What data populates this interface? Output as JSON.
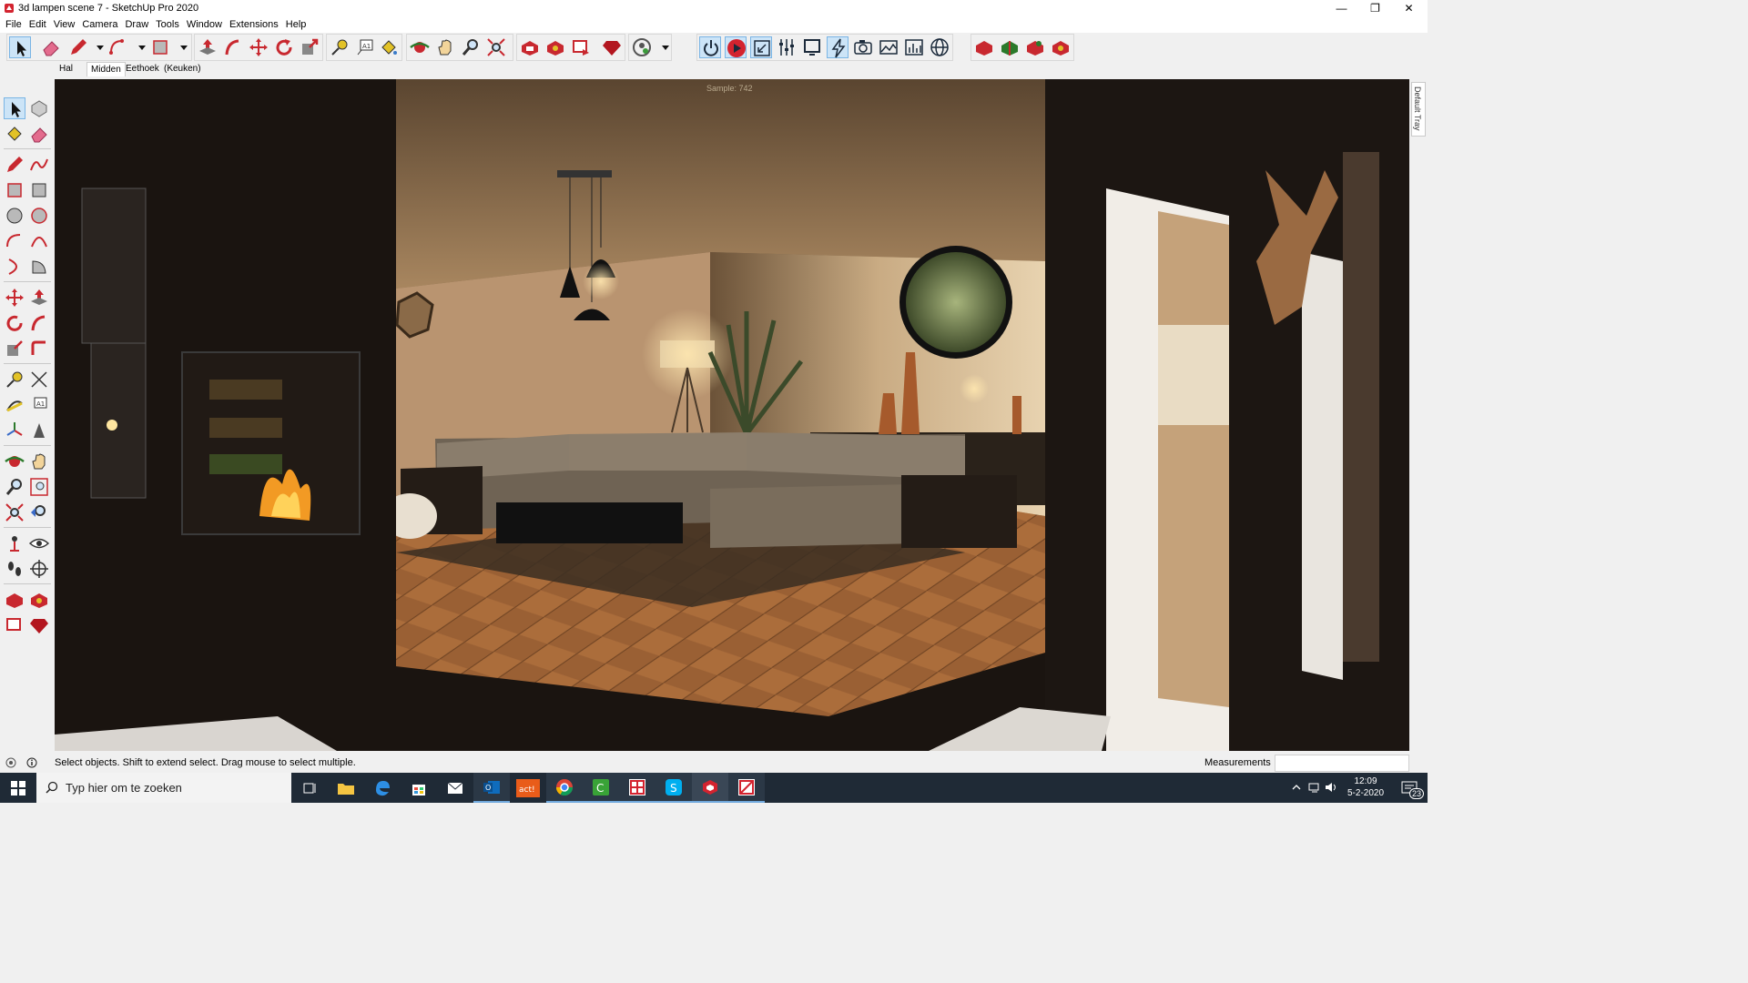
{
  "window": {
    "title": "3d lampen scene 7 - SketchUp Pro 2020",
    "minimize": "—",
    "maximize": "❐",
    "close": "✕"
  },
  "menu": [
    "File",
    "Edit",
    "View",
    "Camera",
    "Draw",
    "Tools",
    "Window",
    "Extensions",
    "Help"
  ],
  "scene_tabs": [
    {
      "label": "Hal",
      "active": false
    },
    {
      "label": "Midden",
      "active": true
    },
    {
      "label": "Eethoek",
      "active": false
    },
    {
      "label": "(Keuken)",
      "active": false
    }
  ],
  "toolbar_icons": [
    "select-icon",
    "eraser-icon",
    "pencil-icon",
    "dropdown-arrow",
    "arc-icon",
    "dropdown-arrow",
    "rectangle-icon",
    "dropdown-arrow",
    "push-pull-icon",
    "follow-me-icon",
    "move-icon",
    "rotate-icon",
    "scale-icon",
    "tape-measure-icon",
    "text-icon",
    "paint-bucket-icon",
    "orbit-icon",
    "pan-icon",
    "zoom-icon",
    "zoom-extents-icon",
    "warehouse-icon",
    "extension-warehouse-icon",
    "send-to-layout-icon",
    "ruby-icon",
    "user-account-icon",
    "dropdown-arrow",
    "render-power-icon",
    "render-start-icon",
    "render-resize-icon",
    "render-settings-icon",
    "render-frame-icon",
    "render-interactive-icon",
    "render-camera-icon",
    "render-image-icon",
    "render-histogram-icon",
    "render-environment-icon",
    "scene-export-icon",
    "component-icon",
    "plugin-icon",
    "gem-icon"
  ],
  "viewport": {
    "sample_text": "Sample: 742"
  },
  "tray": {
    "label": "Default Tray"
  },
  "status": {
    "hint": "Select objects. Shift to extend select. Drag mouse to select multiple.",
    "measurements_label": "Measurements",
    "measurements_value": ""
  },
  "taskbar": {
    "search_placeholder": "Typ hier om te zoeken",
    "time": "12:09",
    "date": "5-2-2020",
    "notifications": "23"
  }
}
